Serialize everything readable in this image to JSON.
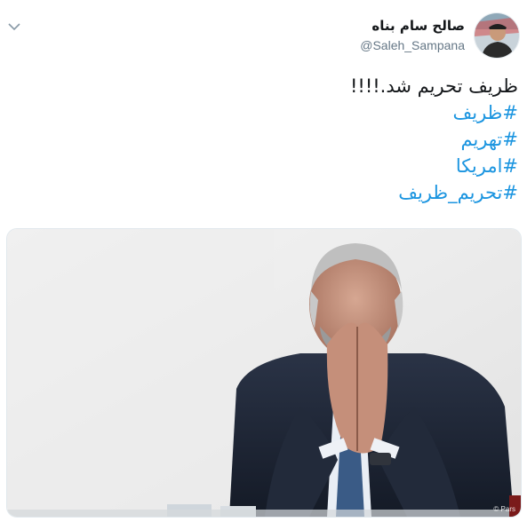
{
  "tweet": {
    "author": {
      "display_name": "صالح سام بناه",
      "handle": "@Saleh_Sampana",
      "avatar_icon": "user-avatar-icon"
    },
    "menu_icon": "chevron-down-icon",
    "text_line": "ظریف تحریم شد.!!!!",
    "hashtags": [
      "#ظریف",
      "#تهریم",
      "#امریکا",
      "#تحریم_ظریف"
    ],
    "hashtag_color": "#1b95e0",
    "media": {
      "watermark": "© Pars"
    }
  }
}
